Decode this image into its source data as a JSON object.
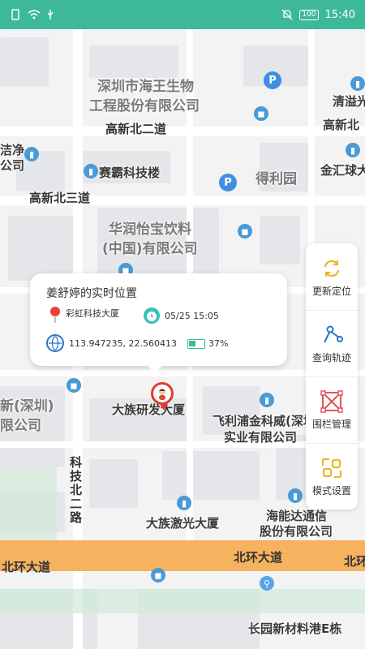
{
  "status_bar": {
    "time": "15:40",
    "battery": "100"
  },
  "map": {
    "labels": {
      "company1_line1": "深圳市海王生物",
      "company1_line2": "工程股份有限公司",
      "road_gaoxin_n2": "高新北二道",
      "saiba": "赛霸科技楼",
      "deliyuan": "得利园",
      "qingyi": "清溢光",
      "gaoxin_right": "高新北",
      "jinhui": "金汇球大",
      "road_gaoxin_n3": "高新北三道",
      "huarun_line1": "华润怡宝饮料",
      "huarun_line2": "(中国)有限公司",
      "jiejing_line1": "洁净",
      "jiejing_line2": "公司",
      "left_cut_line1": "新(深圳)",
      "left_cut_line2": "限公司",
      "dazu_yanfa": "大族研发大厦",
      "feilipu_line1": "飞利浦金科威(深圳)",
      "feilipu_line2": "实业有限公司",
      "keji_bei_road": "科技北二路",
      "dazu_jiguang": "大族激光大厦",
      "haineng_line1": "海能达通信",
      "haineng_line2": "股份有限公司",
      "beihuan_left": "北环大道",
      "beihuan_center": "北环大道",
      "beihuan_right": "北环",
      "changyuan": "长园新材料港E栋"
    }
  },
  "popup": {
    "title": "姜舒婷的实时位置",
    "place": "彩虹科技大厦",
    "datetime": "05/25 15:05",
    "coords": "113.947235, 22.560413",
    "battery": "37%"
  },
  "sidebar": {
    "items": [
      {
        "label": "更新定位",
        "icon": "refresh-icon"
      },
      {
        "label": "查询轨迹",
        "icon": "track-icon"
      },
      {
        "label": "围栏管理",
        "icon": "fence-icon"
      },
      {
        "label": "模式设置",
        "icon": "mode-icon"
      }
    ]
  },
  "colors": {
    "status_bar": "#3db99a",
    "highway": "#f6b25e",
    "accent": "#f0b429"
  }
}
